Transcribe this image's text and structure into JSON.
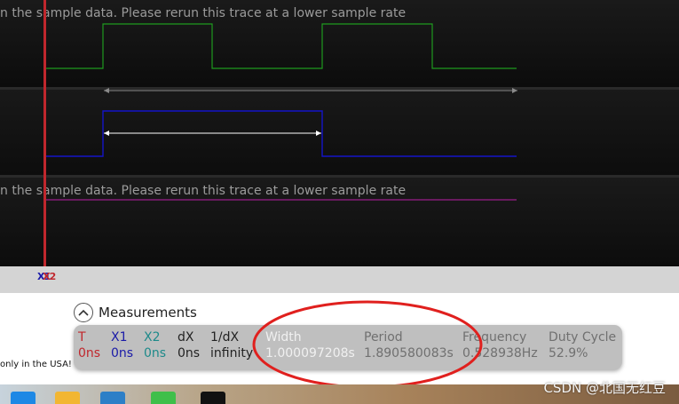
{
  "traces": {
    "lane1_warning": "n the sample data. Please rerun this trace at a lower sample rate",
    "lane3_warning": "n the sample data. Please rerun this trace at a lower sample rate",
    "lane1_color": "#1f9a1f",
    "lane2_color": "#1414c8",
    "lane3_color": "#9a1f8a"
  },
  "cursors": {
    "tag_x1": "X1",
    "tag_x2": "X2",
    "cursor_color": "#c0272d"
  },
  "measurements": {
    "title": "Measurements",
    "columns": [
      {
        "label": "T",
        "value": "0ns"
      },
      {
        "label": "X1",
        "value": "0ns"
      },
      {
        "label": "X2",
        "value": "0ns"
      },
      {
        "label": "dX",
        "value": "0ns"
      },
      {
        "label": "1/dX",
        "value": "infinity"
      },
      {
        "label": "Width",
        "value": "1.000097208s"
      },
      {
        "label": "Period",
        "value": "1.890580083s"
      },
      {
        "label": "Frequency",
        "value": "0.528938Hz"
      },
      {
        "label": "Duty Cycle",
        "value": "52.9%"
      }
    ]
  },
  "side_note": "only in the USA!",
  "watermark": "CSDN @北国无红豆"
}
